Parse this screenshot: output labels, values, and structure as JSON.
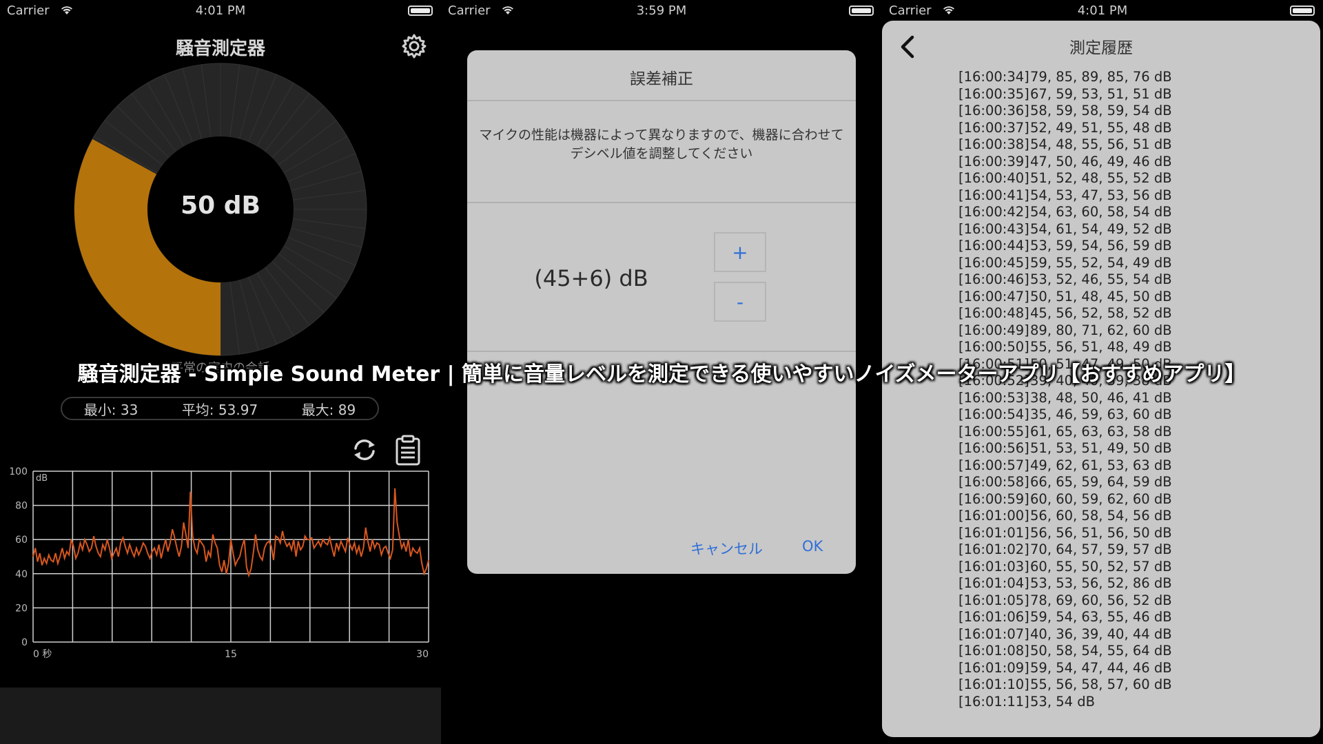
{
  "status_bars": [
    {
      "carrier": "Carrier",
      "time": "4:01 PM"
    },
    {
      "carrier": "Carrier",
      "time": "3:59 PM"
    },
    {
      "carrier": "Carrier",
      "time": "4:01 PM"
    }
  ],
  "meter": {
    "title": "騒音測定器",
    "current_db": "50 dB",
    "gauge_level_db": 50,
    "gauge_max_db": 100,
    "subtitle": "平常の室内の会話",
    "stats": {
      "min": "最小: 33",
      "avg": "平均: 53.97",
      "max": "最大: 89"
    },
    "colors": {
      "gauge_fill": "#b5730b",
      "gauge_track": "#262626",
      "line": "#d8571f"
    }
  },
  "chart_data": {
    "type": "line",
    "title": "",
    "unit_label": "dB",
    "ylim": [
      0,
      100
    ],
    "y_ticks": [
      "0",
      "20",
      "40",
      "60",
      "80",
      "100"
    ],
    "xlim": [
      0,
      30
    ],
    "x_ticks": [
      "0 秒",
      "15",
      "30"
    ],
    "series": [
      {
        "values": [
          50,
          55,
          47,
          52,
          45,
          49,
          46,
          51,
          48,
          47,
          52,
          46,
          50,
          55,
          49,
          53,
          51,
          60,
          56,
          49,
          52,
          58,
          54,
          60,
          57,
          53,
          55,
          62,
          56,
          52,
          50,
          57,
          54,
          60,
          55,
          49,
          52,
          55,
          50,
          58,
          61,
          56,
          52,
          57,
          53,
          50,
          55,
          51,
          54,
          58,
          56,
          52,
          49,
          53,
          55,
          51,
          57,
          49,
          55,
          60,
          53,
          58,
          66,
          61,
          55,
          50,
          56,
          70,
          63,
          55,
          88,
          62,
          55,
          52,
          60,
          58,
          56,
          47,
          53,
          50,
          63,
          58,
          55,
          45,
          41,
          48,
          40,
          46,
          60,
          52,
          45,
          48,
          50,
          56,
          60,
          44,
          39,
          43,
          52,
          63,
          54,
          50,
          48,
          55,
          58,
          59,
          56,
          48,
          62,
          61,
          58,
          65,
          59,
          56,
          58,
          54,
          60,
          50,
          59,
          54,
          56,
          62,
          60,
          60,
          61,
          55,
          57,
          59,
          56,
          60,
          58,
          57,
          61,
          55,
          50,
          58,
          54,
          59,
          56,
          53,
          61,
          57,
          54,
          58,
          52,
          56,
          50,
          55,
          67,
          59,
          53,
          60,
          55,
          58,
          57,
          51,
          55,
          56,
          52,
          49,
          54,
          90,
          70,
          62,
          55,
          58,
          53,
          60,
          50,
          55,
          53,
          52,
          55,
          46,
          40,
          43,
          48
        ]
      }
    ]
  },
  "dialog": {
    "title": "誤差補正",
    "message": "マイクの性能は機器によって異なりますので、機器に合わせてデシベル値を調整してください",
    "value": "(45+6) dB",
    "plus": "+",
    "minus": "-",
    "cancel": "キャンセル",
    "ok": "OK"
  },
  "history": {
    "title": "測定履歴",
    "rows": [
      {
        "ts": "[16:00:34]",
        "v": "79, 85, 89, 85, 76 dB"
      },
      {
        "ts": "[16:00:35]",
        "v": "67, 59, 53, 51, 51 dB"
      },
      {
        "ts": "[16:00:36]",
        "v": "58, 59, 58, 59, 54 dB"
      },
      {
        "ts": "[16:00:37]",
        "v": "52, 49, 51, 55, 48 dB"
      },
      {
        "ts": "[16:00:38]",
        "v": "54, 48, 55, 56, 51 dB"
      },
      {
        "ts": "[16:00:39]",
        "v": "47, 50, 46, 49, 46 dB"
      },
      {
        "ts": "[16:00:40]",
        "v": "51, 52, 48, 55, 52 dB"
      },
      {
        "ts": "[16:00:41]",
        "v": "54, 53, 47, 53, 56 dB"
      },
      {
        "ts": "[16:00:42]",
        "v": "54, 63, 60, 58, 54 dB"
      },
      {
        "ts": "[16:00:43]",
        "v": "54, 61, 54, 49, 52 dB"
      },
      {
        "ts": "[16:00:44]",
        "v": "53, 59, 54, 56, 59 dB"
      },
      {
        "ts": "[16:00:45]",
        "v": "59, 55, 52, 54, 49 dB"
      },
      {
        "ts": "[16:00:46]",
        "v": "53, 52, 46, 55, 54 dB"
      },
      {
        "ts": "[16:00:47]",
        "v": "50, 51, 48, 45, 50 dB"
      },
      {
        "ts": "[16:00:48]",
        "v": "45, 56, 52, 58, 52 dB"
      },
      {
        "ts": "[16:00:49]",
        "v": "89, 80, 71, 62, 60 dB"
      },
      {
        "ts": "[16:00:50]",
        "v": "55, 56, 51, 48, 49 dB"
      },
      {
        "ts": "[16:00:51]",
        "v": "50, 51, 47, 49, 50 dB"
      },
      {
        "ts": "[16:00:52]",
        "v": "39, 40, 40, 39, 38 dB"
      },
      {
        "ts": "[16:00:53]",
        "v": "38, 48, 50, 46, 41 dB"
      },
      {
        "ts": "[16:00:54]",
        "v": "35, 46, 59, 63, 60 dB"
      },
      {
        "ts": "[16:00:55]",
        "v": "61, 65, 63, 63, 58 dB"
      },
      {
        "ts": "[16:00:56]",
        "v": "51, 53, 51, 49, 50 dB"
      },
      {
        "ts": "[16:00:57]",
        "v": "49, 62, 61, 53, 63 dB"
      },
      {
        "ts": "[16:00:58]",
        "v": "66, 65, 59, 64, 59 dB"
      },
      {
        "ts": "[16:00:59]",
        "v": "60, 60, 59, 62, 60 dB"
      },
      {
        "ts": "[16:01:00]",
        "v": "56, 60, 58, 54, 56 dB"
      },
      {
        "ts": "[16:01:01]",
        "v": "56, 56, 51, 56, 50 dB"
      },
      {
        "ts": "[16:01:02]",
        "v": "70, 64, 57, 59, 57 dB"
      },
      {
        "ts": "[16:01:03]",
        "v": "60, 55, 50, 52, 57 dB"
      },
      {
        "ts": "[16:01:04]",
        "v": "53, 53, 56, 52, 86 dB"
      },
      {
        "ts": "[16:01:05]",
        "v": "78, 69, 60, 56, 52 dB"
      },
      {
        "ts": "[16:01:06]",
        "v": "59, 54, 63, 55, 46 dB"
      },
      {
        "ts": "[16:01:07]",
        "v": "40, 36, 39, 40, 44 dB"
      },
      {
        "ts": "[16:01:08]",
        "v": "50, 58, 54, 55, 64 dB"
      },
      {
        "ts": "[16:01:09]",
        "v": "59, 54, 47, 44, 46 dB"
      },
      {
        "ts": "[16:01:10]",
        "v": "55, 56, 58, 57, 60 dB"
      },
      {
        "ts": "[16:01:11]",
        "v": "53, 54 dB"
      }
    ]
  },
  "banner": "騒音測定器 - Simple Sound Meter | 簡単に音量レベルを測定できる使いやすいノイズメーターアプリ【おすすめアプリ】"
}
